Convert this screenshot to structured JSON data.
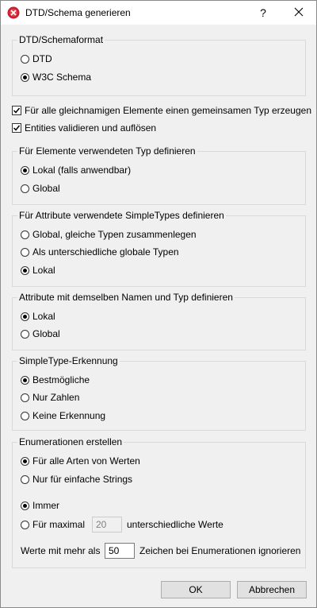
{
  "window": {
    "title": "DTD/Schema generieren",
    "help": "?",
    "close_icon": "close-icon",
    "app_icon": "app-icon"
  },
  "format_group": {
    "label": "DTD/Schemaformat",
    "options": [
      {
        "label": "DTD",
        "checked": false
      },
      {
        "label": "W3C Schema",
        "checked": true
      }
    ]
  },
  "checkboxes": [
    {
      "label": "Für alle gleichnamigen Elemente einen gemeinsamen Typ erzeugen",
      "checked": true
    },
    {
      "label": "Entities validieren und auflösen",
      "checked": true
    }
  ],
  "element_type_group": {
    "label": "Für Elemente verwendeten Typ definieren",
    "options": [
      {
        "label": "Lokal (falls anwendbar)",
        "checked": true
      },
      {
        "label": "Global",
        "checked": false
      }
    ]
  },
  "attribute_simpletype_group": {
    "label": "Für Attribute verwendete SimpleTypes definieren",
    "options": [
      {
        "label": "Global, gleiche Typen zusammenlegen",
        "checked": false
      },
      {
        "label": "Als unterschiedliche globale Typen",
        "checked": false
      },
      {
        "label": "Lokal",
        "checked": true
      }
    ]
  },
  "attribute_same_name_group": {
    "label": "Attribute mit demselben Namen und Typ definieren",
    "options": [
      {
        "label": "Lokal",
        "checked": true
      },
      {
        "label": "Global",
        "checked": false
      }
    ]
  },
  "simpletype_detection_group": {
    "label": "SimpleType-Erkennung",
    "options": [
      {
        "label": "Bestmögliche",
        "checked": true
      },
      {
        "label": "Nur Zahlen",
        "checked": false
      },
      {
        "label": "Keine Erkennung",
        "checked": false
      }
    ]
  },
  "enumerations_group": {
    "label": "Enumerationen erstellen",
    "value_options": [
      {
        "label": "Für alle Arten von Werten",
        "checked": true
      },
      {
        "label": "Nur für einfache Strings",
        "checked": false
      }
    ],
    "when_options": [
      {
        "label": "Immer",
        "checked": true
      },
      {
        "label": "Für maximal",
        "checked": false
      }
    ],
    "max_value": "20",
    "max_suffix": "unterschiedliche Werte",
    "ignore_prefix": "Werte mit mehr als",
    "ignore_value": "50",
    "ignore_suffix": "Zeichen bei Enumerationen ignorieren"
  },
  "buttons": {
    "ok": "OK",
    "cancel": "Abbrechen"
  }
}
